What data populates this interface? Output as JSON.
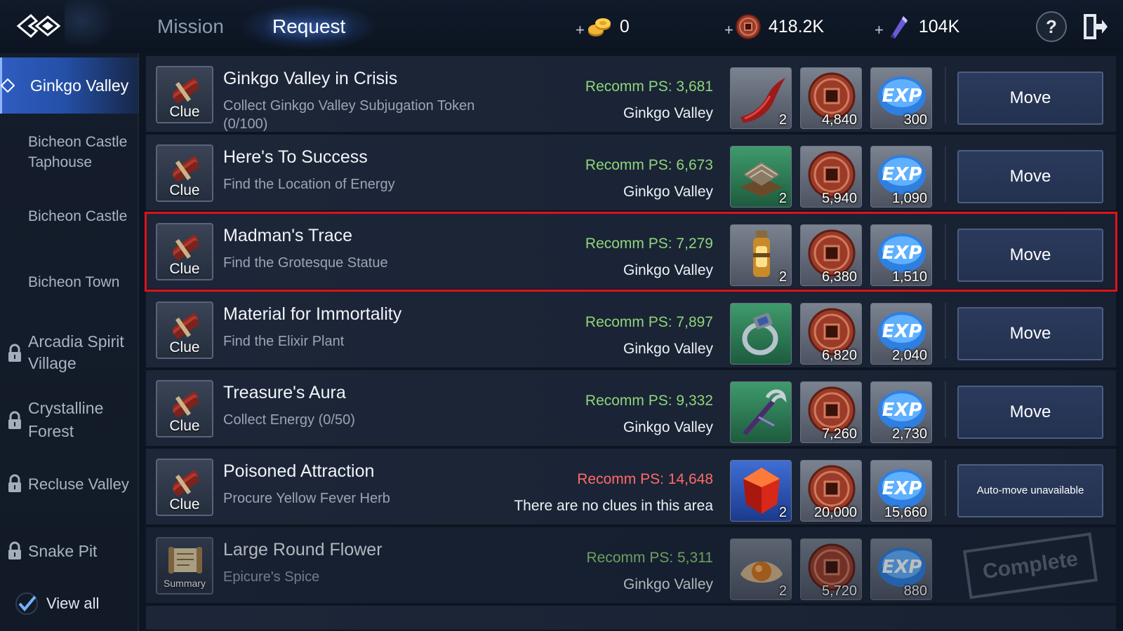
{
  "tabs": {
    "mission": "Mission",
    "request": "Request"
  },
  "currencies": {
    "gold": "0",
    "coin": "418.2K",
    "crystal": "104K",
    "plus": "+"
  },
  "help_label": "?",
  "sidebar": {
    "items": [
      {
        "label": "Ginkgo Valley",
        "active": true,
        "locked": false
      },
      {
        "label": "Bicheon Castle Taphouse",
        "locked": false
      },
      {
        "label": "Bicheon Castle",
        "locked": false
      },
      {
        "label": "Bicheon Town",
        "locked": false
      },
      {
        "label": "Arcadia Spirit Village",
        "locked": true
      },
      {
        "label": "Crystalline Forest",
        "locked": true
      },
      {
        "label": "Recluse Valley",
        "locked": true
      },
      {
        "label": "Snake Pit",
        "locked": true
      }
    ],
    "view_all": "View all"
  },
  "quests": [
    {
      "badge": "Clue",
      "title": "Ginkgo Valley in Crisis",
      "desc": "Collect Ginkgo Valley Subjugation Token (0/100)",
      "ps": "Recomm PS: 3,681",
      "area": "Ginkgo Valley",
      "reward_item_qty": "2",
      "reward_coin": "4,840",
      "reward_exp": "300",
      "button": "Move"
    },
    {
      "badge": "Clue",
      "title": "Here's To Success",
      "desc": "Find the Location of Energy",
      "ps": "Recomm PS: 6,673",
      "area": "Ginkgo Valley",
      "reward_item_qty": "2",
      "reward_coin": "5,940",
      "reward_exp": "1,090",
      "button": "Move"
    },
    {
      "badge": "Clue",
      "title": "Madman's Trace",
      "desc": "Find the Grotesque Statue",
      "ps": "Recomm PS: 7,279",
      "area": "Ginkgo Valley",
      "reward_item_qty": "2",
      "reward_coin": "6,380",
      "reward_exp": "1,510",
      "button": "Move"
    },
    {
      "badge": "Clue",
      "title": "Material for Immortality",
      "desc": "Find the Elixir Plant",
      "ps": "Recomm PS: 7,897",
      "area": "Ginkgo Valley",
      "reward_item_qty": "",
      "reward_coin": "6,820",
      "reward_exp": "2,040",
      "button": "Move"
    },
    {
      "badge": "Clue",
      "title": "Treasure's Aura",
      "desc": "Collect Energy (0/50)",
      "ps": "Recomm PS: 9,332",
      "area": "Ginkgo Valley",
      "reward_item_qty": "",
      "reward_coin": "7,260",
      "reward_exp": "2,730",
      "button": "Move"
    },
    {
      "badge": "Clue",
      "title": "Poisoned Attraction",
      "desc": "Procure Yellow Fever Herb",
      "ps": "Recomm PS: 14,648",
      "area": "There are no clues in this area",
      "reward_item_qty": "2",
      "reward_coin": "20,000",
      "reward_exp": "15,660",
      "button": "Auto-move unavailable"
    },
    {
      "badge": "Summary",
      "title": "Large Round Flower",
      "desc": "Epicure's Spice",
      "ps": "Recomm PS: 5,311",
      "area": "Ginkgo Valley",
      "reward_item_qty": "2",
      "reward_coin": "5,720",
      "reward_exp": "880",
      "stamp": "Complete"
    }
  ],
  "colors": {
    "ps_ok": "#8fd57a",
    "ps_high": "#ff6a6a",
    "selection": "#e0121a",
    "active_tab_bg": "#2f5cc0"
  },
  "icons": {
    "coin_reward": "bronze-square-hole-coin-icon",
    "exp_reward": "exp-orb-icon"
  }
}
